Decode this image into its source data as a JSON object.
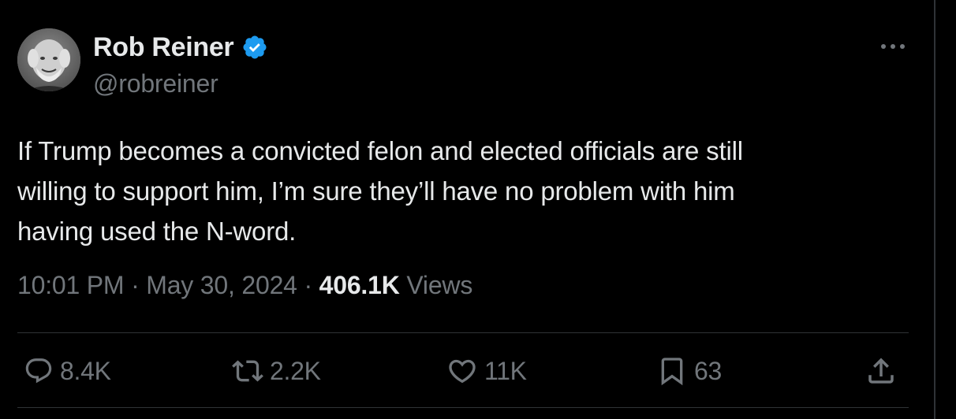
{
  "author": {
    "display_name": "Rob Reiner",
    "handle": "@robreiner",
    "verified": true
  },
  "tweet": {
    "text_lines": [
      "If Trump becomes a convicted felon and elected officials are still",
      "willing to support him, I’m sure they’ll have no problem with him",
      "having used the N-word."
    ],
    "time": "10:01 PM",
    "separator": "·",
    "date": "May 30, 2024",
    "views_count": "406.1K",
    "views_label": "Views"
  },
  "actions": {
    "reply_count": "8.4K",
    "repost_count": "2.2K",
    "like_count": "11K",
    "bookmark_count": "63"
  },
  "icons": {
    "more": "more-horizontal-icon",
    "reply": "reply-bubble-icon",
    "repost": "repost-arrows-icon",
    "like": "heart-icon",
    "bookmark": "bookmark-icon",
    "share": "share-upload-icon",
    "verified": "verified-badge-icon"
  },
  "colors": {
    "background": "#000000",
    "primary_text": "#e7e9ea",
    "secondary_text": "#71767b",
    "verified_blue": "#1d9bf0",
    "divider": "#2f3336"
  }
}
